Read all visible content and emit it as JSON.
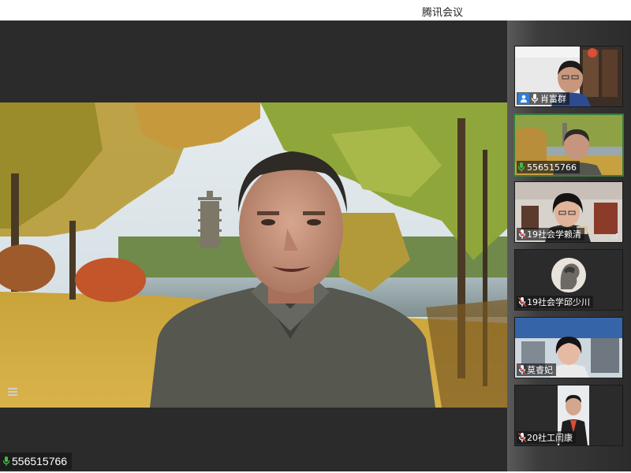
{
  "window": {
    "title": "腾讯会议"
  },
  "main_video": {
    "speaker_id": "556515766",
    "icons": {
      "mic": "mic-icon",
      "menu": "menu-icon"
    }
  },
  "participants": [
    {
      "name": "肖富群",
      "host": true,
      "icon": "user-icon",
      "mic": "mic-icon"
    },
    {
      "name": "556515766",
      "active": true,
      "mic": "mic-icon"
    },
    {
      "name": "19社会学赖清",
      "mic": "mic-muted-icon"
    },
    {
      "name": "19社会学邱少川",
      "mic": "mic-muted-icon"
    },
    {
      "name": "莫睿妃",
      "mic": "mic-muted-icon"
    },
    {
      "name": "20社工闫康",
      "mic": "mic-muted-icon"
    }
  ],
  "colors": {
    "accent_green": "#3a7c3a",
    "host_badge": "#2d7ee0",
    "mic_green": "#3fbf3f"
  }
}
